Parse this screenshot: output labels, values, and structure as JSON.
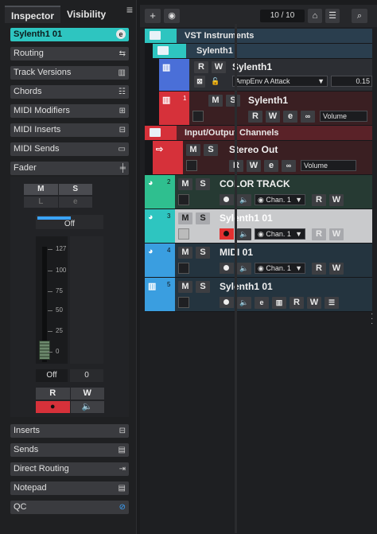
{
  "inspector": {
    "tabs": [
      "Inspector",
      "Visibility"
    ],
    "menu_icon": "menu-icon",
    "track_name": "Sylenth1 01",
    "sections": [
      {
        "label": "Routing",
        "icon": "routing-icon"
      },
      {
        "label": "Track Versions",
        "icon": "versions-icon"
      },
      {
        "label": "Chords",
        "icon": "chords-icon"
      },
      {
        "label": "MIDI Modifiers",
        "icon": "modifiers-icon"
      },
      {
        "label": "MIDI Inserts",
        "icon": "inserts-icon"
      },
      {
        "label": "MIDI Sends",
        "icon": "sends-icon"
      },
      {
        "label": "Fader",
        "icon": "fader-icon"
      }
    ],
    "fader": {
      "mute": "M",
      "solo": "S",
      "listen": "L",
      "edit": "e",
      "meter_label": "Off",
      "scale": [
        "127",
        "100",
        "75",
        "50",
        "25",
        "0"
      ],
      "left_value": "Off",
      "right_value": "0",
      "read": "R",
      "write": "W"
    },
    "bottom_sections": [
      {
        "label": "Inserts",
        "icon": "inserts-icon"
      },
      {
        "label": "Sends",
        "icon": "sends-icon"
      },
      {
        "label": "Direct Routing",
        "icon": "direct-routing-icon"
      },
      {
        "label": "Notepad",
        "icon": "notepad-icon"
      },
      {
        "label": "QC",
        "icon": "qc-icon"
      }
    ]
  },
  "project": {
    "add_label": "+",
    "track_count": "10 / 10",
    "folders": {
      "vst": "VST Instruments",
      "sylenth": "Sylenth1",
      "io": "Input/Output Channels"
    },
    "tracks": [
      {
        "num": "",
        "name": "Sylenth1",
        "param": "AmpEnv A Attack",
        "value": "0.15"
      },
      {
        "num": "1",
        "name": "Sylenth1",
        "param": "Volume"
      },
      {
        "num": "",
        "name": "Stereo Out",
        "param": "Volume"
      },
      {
        "num": "2",
        "name": "COLOR TRACK",
        "channel": "Chan. 1"
      },
      {
        "num": "3",
        "name": "Sylenth1 01",
        "channel": "Chan. 1"
      },
      {
        "num": "4",
        "name": "MIDI 01",
        "channel": "Chan. 1"
      },
      {
        "num": "5",
        "name": "Sylenth1 01"
      }
    ],
    "buttons": {
      "m": "M",
      "s": "S",
      "r": "R",
      "w": "W",
      "e": "e"
    }
  },
  "colors": {
    "cyan": "#2ec5c0",
    "blue": "#4a6fd8",
    "red": "#d6313a",
    "green": "#2fbf8f",
    "lightblue": "#3a9ee0"
  }
}
